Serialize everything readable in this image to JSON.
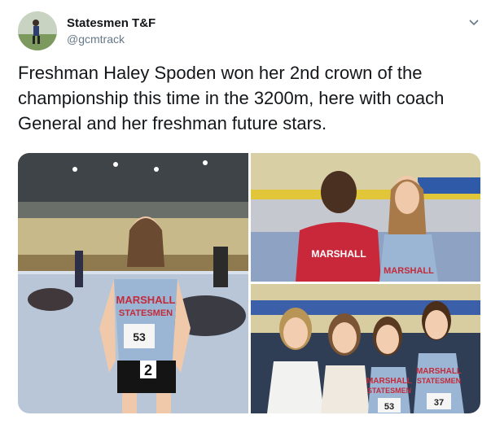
{
  "author": {
    "display_name": "Statesmen T&F",
    "handle": "@gcmtrack",
    "avatar_icon": "runner-avatar"
  },
  "tweet": {
    "text": "Freshman Haley Spoden won her 2nd crown of the championship this time in the 3200m, here with coach General and her freshman future stars."
  },
  "menu": {
    "icon": "chevron-down-icon"
  },
  "photos": {
    "photo_1": {
      "jersey_text_1": "MARSHALL",
      "jersey_text_2": "STATESMEN",
      "bib": "53",
      "hip_number": "2"
    },
    "photo_2": {
      "shirt_text": "MARSHALL",
      "jersey_text": "MARSHALL"
    },
    "photo_3": {
      "jersey_text_1": "MARSHALL",
      "jersey_text_2": "STATESMEN",
      "bib_1": "53",
      "bib_2": "37"
    }
  },
  "colors": {
    "name": "#14171a",
    "handle": "#657786",
    "jersey": "#9bb6d4",
    "track_floor": "#b8c6d8",
    "red_shirt": "#c8283a"
  }
}
